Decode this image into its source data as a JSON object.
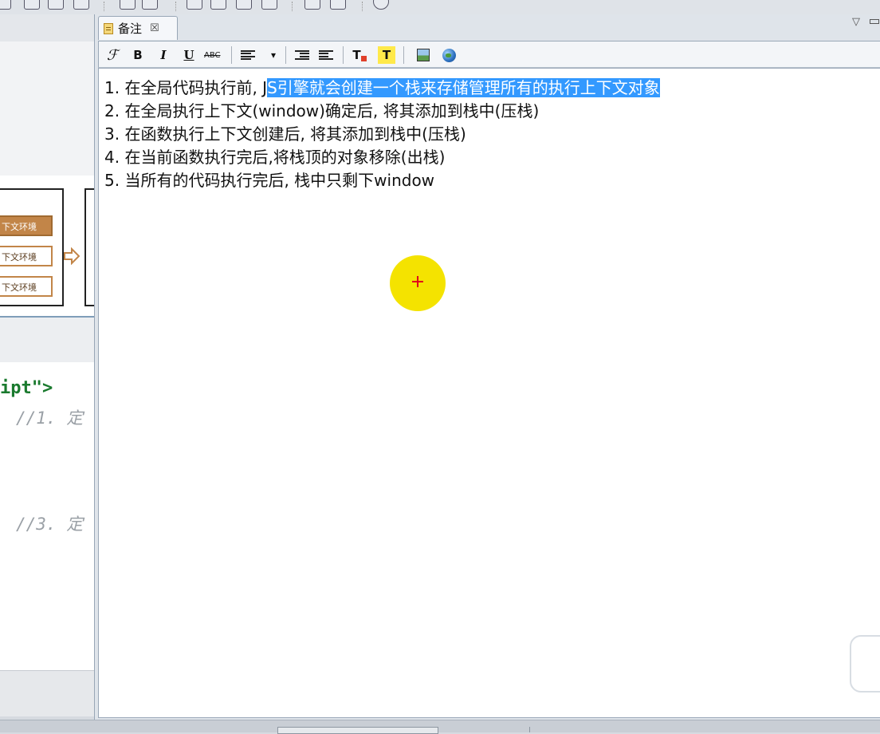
{
  "notes_panel": {
    "tab_label": "备注",
    "tab_close": "☒",
    "panel_menu_glyph": "▽",
    "toolbar": {
      "font_label": "ℱ",
      "bold_label": "B",
      "italic_label": "I",
      "underline_label": "U",
      "strike_label": "ABC",
      "dropdown_glyph": "▾",
      "text_color_label": "T",
      "highlight_label": "T"
    },
    "lines": [
      {
        "number": "1.",
        "plain": " 在全局代码执行前, J",
        "selected": "S引擎就会创建一个栈来存储管理所有的执行上下文对象"
      },
      {
        "number": "2.",
        "plain": " 在全局执行上下文(window)确定后, 将其添加到栈中(压栈)",
        "selected": ""
      },
      {
        "number": "3.",
        "plain": " 在函数执行上下文创建后, 将其添加到栈中(压栈)",
        "selected": ""
      },
      {
        "number": "4.",
        "plain": " 在当前函数执行完后,将栈顶的对象移除(出栈)",
        "selected": ""
      },
      {
        "number": "5.",
        "plain": " 当所有的代码执行完后, 栈中只剩下window",
        "selected": ""
      }
    ]
  },
  "left_editor": {
    "diagram_boxes": [
      "下文环境",
      "下文环境",
      "下文环境"
    ],
    "code_tag": "ipt\">",
    "comment_1": "//1. 定",
    "comment_3": "//3. 定"
  },
  "colors": {
    "selection": "#3399ff",
    "cursor_halo": "#f4e300",
    "cursor_cross": "#e0001a",
    "code_string": "#1a7a2e",
    "env_box": "#c28548"
  }
}
